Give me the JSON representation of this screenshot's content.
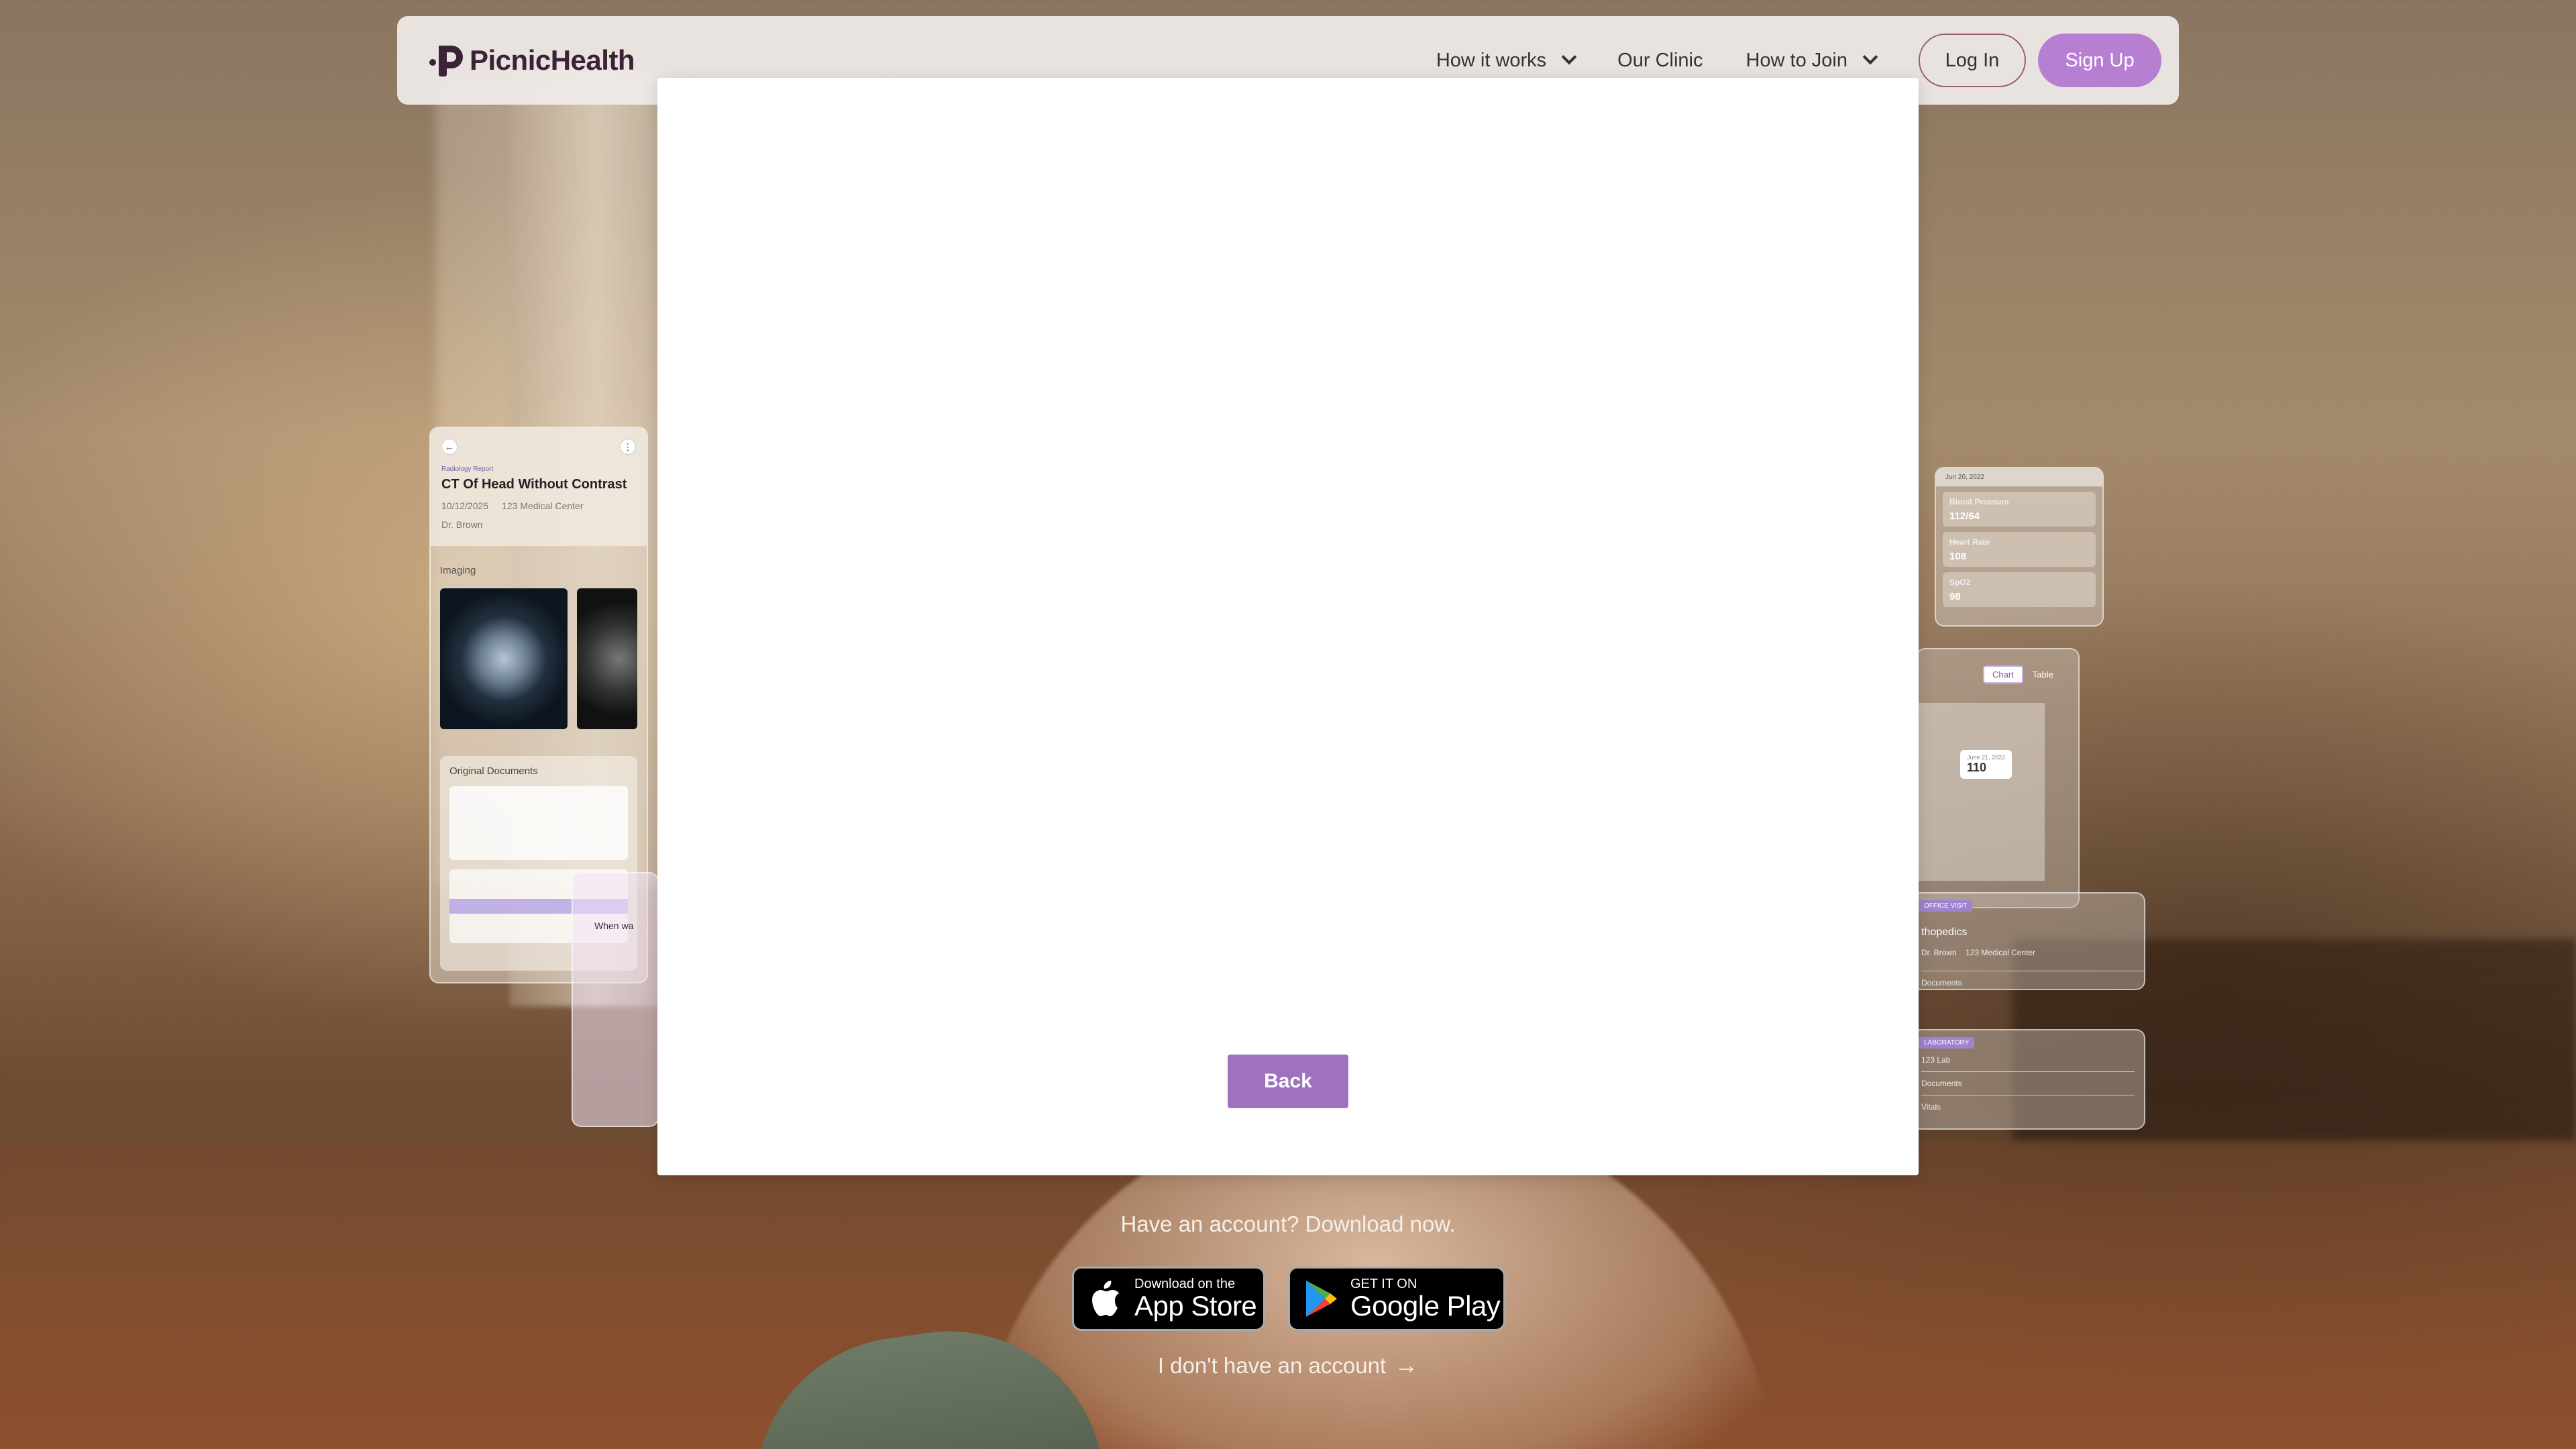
{
  "brand": {
    "name": "PicnicHealth",
    "color": "#3b2238"
  },
  "nav": {
    "links": [
      {
        "label": "How it works",
        "has_dropdown": true
      },
      {
        "label": "Our Clinic",
        "has_dropdown": false
      },
      {
        "label": "How to Join",
        "has_dropdown": true
      }
    ],
    "login_label": "Log In",
    "signup_label": "Sign Up",
    "accent": "#b67fd2"
  },
  "modal": {
    "back_label": "Back",
    "back_color": "#9f72c0"
  },
  "download": {
    "prompt": "Have an account? Download now.",
    "appstore": {
      "small": "Download on the",
      "big": "App Store",
      "icon": "apple-icon"
    },
    "playstore": {
      "small": "GET IT ON",
      "big": "Google Play",
      "icon": "google-play-icon"
    },
    "no_account_label": "I don't have an account"
  },
  "bg_cards": {
    "ct": {
      "type": "Radiology Report",
      "title": "CT Of Head Without Contrast",
      "date": "10/12/2025",
      "location": "123 Medical Center",
      "doctor": "Dr. Brown",
      "imaging_label": "Imaging",
      "docs_label": "Original Documents"
    },
    "chat": {
      "question": "When wa"
    },
    "vitals": {
      "date": "Jun 20, 2022",
      "items": [
        {
          "name": "Blood Pressure",
          "value": "112/64"
        },
        {
          "name": "Heart Rate",
          "value": "108"
        },
        {
          "name": "SpO2",
          "value": "98"
        }
      ]
    },
    "chart": {
      "tab_chart": "Chart",
      "tab_table": "Table",
      "tooltip_date": "June 21, 2022",
      "tooltip_value": "110"
    },
    "office": {
      "badge": "OFFICE VISIT",
      "title": "thopedics",
      "doctor": "Dr. Brown",
      "location": "123 Medical Center",
      "docs": "Documents"
    },
    "lab": {
      "badge": "LABORATORY",
      "name": "123 Lab",
      "docs": "Documents",
      "vitals": "Vitals"
    }
  }
}
